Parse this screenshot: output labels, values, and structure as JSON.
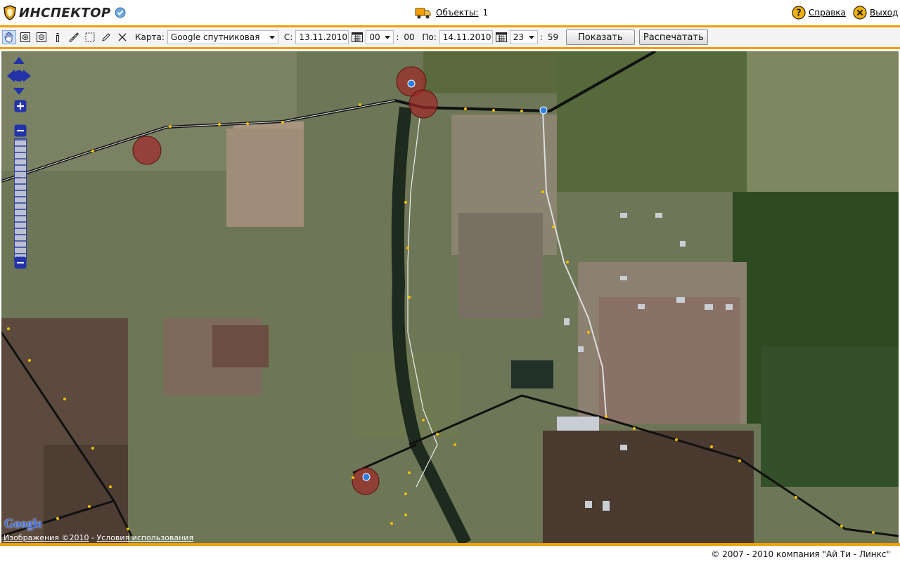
{
  "header": {
    "logo_text": "ИНСПЕКТОР",
    "objects_label": "Объекты:",
    "objects_count": "1",
    "help_label": "Справка",
    "logout_label": "Выход"
  },
  "toolbar": {
    "map_label": "Карта:",
    "map_type": "Google спутниковая",
    "from_label": "С:",
    "from_date": "13.11.2010",
    "from_hour": "00",
    "from_minute": "00",
    "to_label": "По:",
    "to_date": "14.11.2010",
    "to_hour": "23",
    "to_minute": "59",
    "show_button": "Показать",
    "print_button": "Распечатать",
    "colon": ":"
  },
  "map": {
    "google_logo": "Google",
    "imagery_link": "Изображения ©2010",
    "separator": " - ",
    "terms_link": "Условия использования"
  },
  "footer": {
    "copyright": "© 2007 - 2010 компания \"Ай Ти - Линкс\""
  },
  "colors": {
    "accent": "#f0a000",
    "nav_blue": "#2233aa",
    "track": "#111111",
    "stop_marker": "#a02828"
  }
}
